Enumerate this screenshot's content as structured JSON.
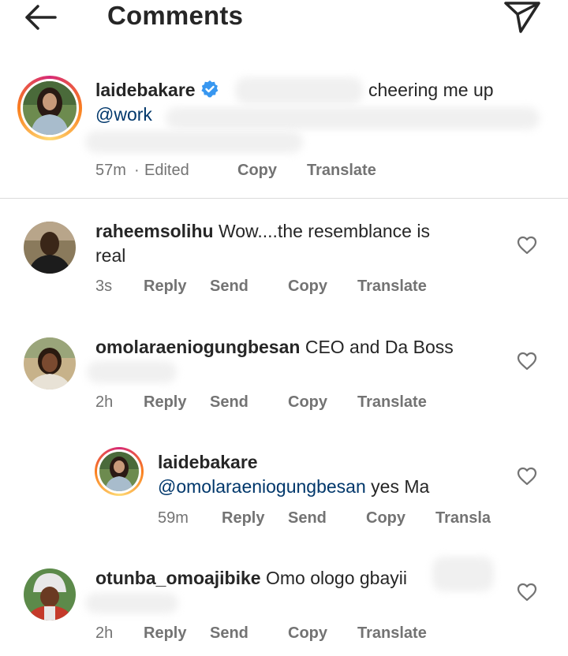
{
  "header": {
    "title": "Comments",
    "back_icon": "arrow-left-icon",
    "send_icon": "paper-plane-icon"
  },
  "caption": {
    "username": "laidebakare",
    "verified": true,
    "text_tail": "cheering me up",
    "mention": "@work",
    "time": "57m",
    "separator": "·",
    "edited": "Edited",
    "copy": "Copy",
    "translate": "Translate"
  },
  "comments": [
    {
      "username": "raheemsolihu",
      "text_line1": "Wow....the resemblance is",
      "text_line2": "real",
      "time": "3s",
      "reply": "Reply",
      "send": "Send",
      "copy": "Copy",
      "translate": "Translate"
    },
    {
      "username": "omolaraeniogungbesan",
      "text": "CEO and Da Boss",
      "time": "2h",
      "reply": "Reply",
      "send": "Send",
      "copy": "Copy",
      "translate": "Translate"
    },
    {
      "username": "laidebakare",
      "mention": "@omolaraeniogungbesan",
      "text": "yes Ma",
      "time": "59m",
      "reply": "Reply",
      "send": "Send",
      "copy": "Copy",
      "translate": "Transla"
    },
    {
      "username": "otunba_omoajibike",
      "text": "Omo ologo gbayii",
      "time": "2h",
      "reply": "Reply",
      "send": "Send",
      "copy": "Copy",
      "translate": "Translate"
    }
  ],
  "colors": {
    "text": "#262626",
    "secondary": "#737373",
    "mention": "#00376b",
    "verified": "#3897f0",
    "story_ring_start": "#feda75",
    "story_ring_end": "#d62976"
  }
}
